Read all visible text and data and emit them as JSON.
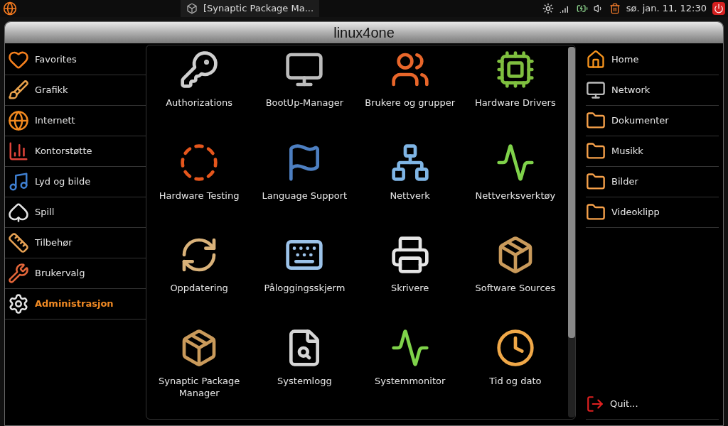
{
  "top_panel": {
    "task_button": "[Synaptic Package Ma...",
    "clock": "sø. jan. 11, 12:30"
  },
  "window": {
    "title": "linux4one"
  },
  "categories": [
    {
      "label": "Favorites",
      "kind": "heart",
      "selected": false
    },
    {
      "label": "Grafikk",
      "kind": "brush",
      "selected": false
    },
    {
      "label": "Internett",
      "kind": "globe",
      "selected": false
    },
    {
      "label": "Kontorstøtte",
      "kind": "chart",
      "selected": false
    },
    {
      "label": "Lyd og bilde",
      "kind": "music",
      "selected": false
    },
    {
      "label": "Spill",
      "kind": "cards",
      "selected": false
    },
    {
      "label": "Tilbehør",
      "kind": "ruler",
      "selected": false
    },
    {
      "label": "Brukervalg",
      "kind": "tools",
      "selected": false
    },
    {
      "label": "Administrasjon",
      "kind": "gear",
      "selected": true
    }
  ],
  "apps": [
    {
      "label": "Authorizations",
      "kind": "keys"
    },
    {
      "label": "BootUp-Manager",
      "kind": "computer"
    },
    {
      "label": "Brukere og grupper",
      "kind": "users"
    },
    {
      "label": "Hardware Drivers",
      "kind": "chip"
    },
    {
      "label": "Hardware Testing",
      "kind": "ring"
    },
    {
      "label": "Language Support",
      "kind": "flag"
    },
    {
      "label": "Nettverk",
      "kind": "network"
    },
    {
      "label": "Nettverksverktøy",
      "kind": "pulse"
    },
    {
      "label": "Oppdatering",
      "kind": "update"
    },
    {
      "label": "Påloggingsskjerm",
      "kind": "login"
    },
    {
      "label": "Skrivere",
      "kind": "printer"
    },
    {
      "label": "Software Sources",
      "kind": "package"
    },
    {
      "label": "Synaptic Package Manager",
      "kind": "package"
    },
    {
      "label": "Systemlogg",
      "kind": "log"
    },
    {
      "label": "Systemmonitor",
      "kind": "pulse"
    },
    {
      "label": "Tid og dato",
      "kind": "clock"
    }
  ],
  "places": [
    {
      "label": "Home",
      "kind": "home"
    },
    {
      "label": "Network",
      "kind": "computer"
    },
    {
      "label": "Dokumenter",
      "kind": "folder"
    },
    {
      "label": "Musikk",
      "kind": "folder"
    },
    {
      "label": "Bilder",
      "kind": "folder"
    },
    {
      "label": "Videoklipp",
      "kind": "folder"
    }
  ],
  "quit": {
    "label": "Quit..."
  }
}
